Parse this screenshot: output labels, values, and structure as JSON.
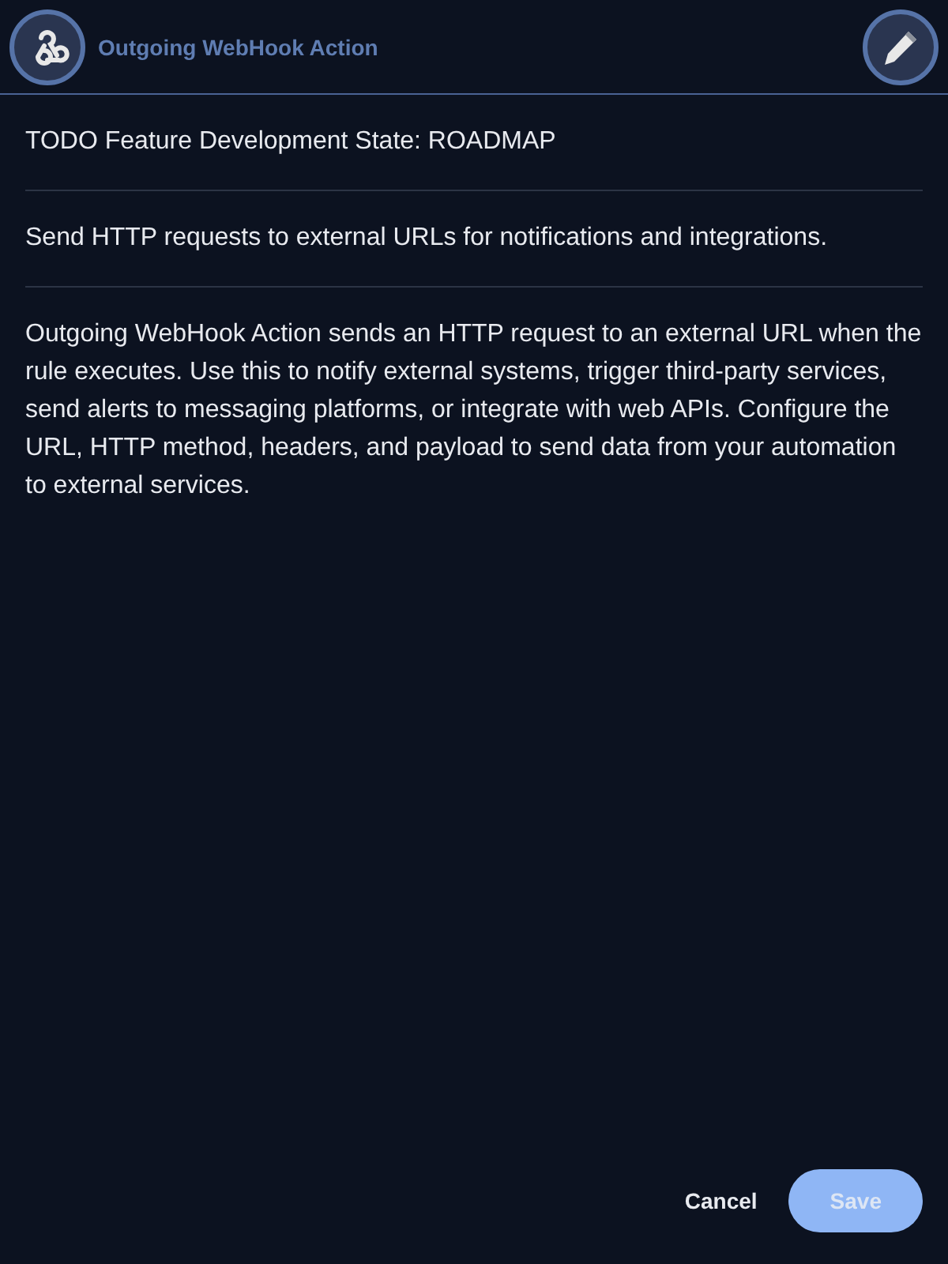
{
  "header": {
    "title": "Outgoing WebHook Action"
  },
  "sections": [
    "TODO Feature Development State: ROADMAP",
    "Send HTTP requests to external URLs for notifications and integrations.",
    "Outgoing WebHook Action sends an HTTP request to an external URL when the rule executes. Use this to notify external systems, trigger third-party services, send alerts to messaging platforms, or integrate with web APIs. Configure the URL, HTTP method, headers, and payload to send data from your automation to external services."
  ],
  "buttons": [
    {
      "label": "Cancel",
      "kind": "text",
      "disabled": false
    },
    {
      "label": "Save",
      "kind": "primary",
      "disabled": true
    }
  ]
}
